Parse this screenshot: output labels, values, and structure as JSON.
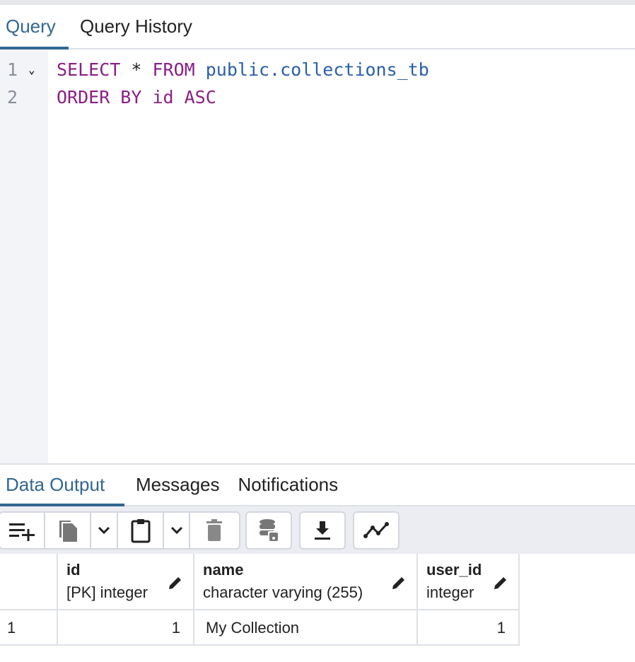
{
  "query_tabs": [
    {
      "label": "Query",
      "active": true
    },
    {
      "label": "Query History",
      "active": false
    }
  ],
  "editor": {
    "lines": [
      {
        "num": "1",
        "tokens": [
          "SELECT",
          " * ",
          "FROM",
          " public.collections_tb"
        ]
      },
      {
        "num": "2",
        "tokens": [
          "ORDER BY id ASC"
        ]
      }
    ]
  },
  "output_tabs": [
    {
      "label": "Data Output",
      "active": true
    },
    {
      "label": "Messages",
      "active": false
    },
    {
      "label": "Notifications",
      "active": false
    }
  ],
  "toolbar": {
    "icons": [
      "add-row-icon",
      "copy-icon",
      "chevron-down-icon",
      "paste-icon",
      "chevron-down-icon",
      "delete-icon",
      "save-data-icon",
      "download-icon",
      "graph-icon"
    ]
  },
  "table": {
    "columns": [
      {
        "name": "id",
        "type": "[PK] integer"
      },
      {
        "name": "name",
        "type": "character varying (255)"
      },
      {
        "name": "user_id",
        "type": "integer"
      }
    ],
    "rows": [
      {
        "rownum": "1",
        "cells": [
          "1",
          "My Collection",
          "1"
        ]
      }
    ]
  },
  "colors": {
    "accent": "#326690",
    "keyword": "#8b1f84",
    "identifier": "#2a5fa8"
  }
}
